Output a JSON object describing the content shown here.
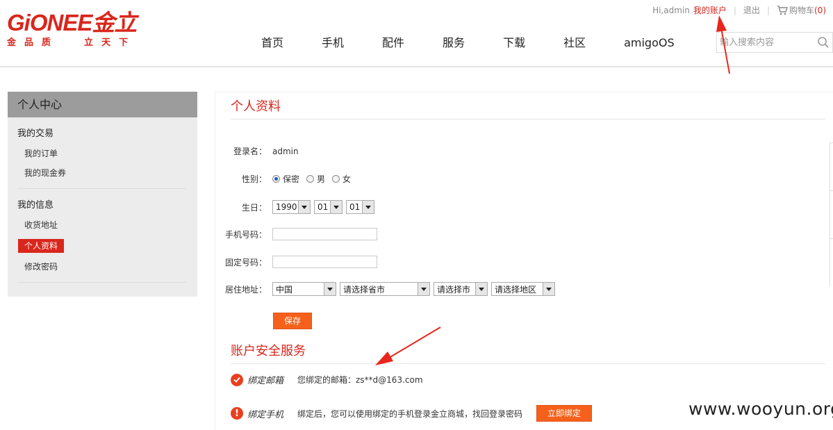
{
  "brand": {
    "logo": "GiONEE金立",
    "tagline": [
      "金",
      "品",
      "质",
      "立",
      "天",
      "下"
    ]
  },
  "topbar": {
    "greeting": "Hi,admin",
    "my_account": "我的账户",
    "logout": "退出",
    "cart_label": "购物车",
    "cart_count": "(0)"
  },
  "nav": [
    "首页",
    "手机",
    "配件",
    "服务",
    "下载",
    "社区",
    "amigoOS"
  ],
  "search": {
    "placeholder": "输入搜索内容"
  },
  "sidebar": {
    "title": "个人中心",
    "groups": [
      {
        "title": "我的交易",
        "items": [
          "我的订单",
          "我的现金券"
        ]
      },
      {
        "title": "我的信息",
        "items": [
          "收货地址",
          "个人资料",
          "修改密码"
        ],
        "active": "个人资料"
      }
    ]
  },
  "profile": {
    "title": "个人资料",
    "login_label": "登录名：",
    "login_value": "admin",
    "gender_label": "性别：",
    "gender_options": [
      "保密",
      "男",
      "女"
    ],
    "gender_selected": "保密",
    "birthday_label": "生日：",
    "birth_year": "1990",
    "birth_month": "01",
    "birth_day": "01",
    "mobile_label": "手机号码：",
    "mobile_value": "",
    "phone_label": "固定号码：",
    "phone_value": "",
    "address_label": "居住地址：",
    "country": "中国",
    "province": "请选择省市",
    "city": "请选择市",
    "district": "请选择地区",
    "save": "保存"
  },
  "security": {
    "title": "账户安全服务",
    "email": {
      "icon": "check-circle-icon",
      "name": "绑定邮箱",
      "desc": "您绑定的邮箱：zs**d@163.com"
    },
    "phone": {
      "icon": "exclamation-circle-icon",
      "name": "绑定手机",
      "desc": "绑定后，您可以使用绑定的手机登录金立商城，找回登录密码",
      "button": "立即绑定"
    }
  },
  "watermark": "www.wooyun.org",
  "colors": {
    "brand_red": "#d9261c",
    "button_orange": "#f5611b"
  }
}
